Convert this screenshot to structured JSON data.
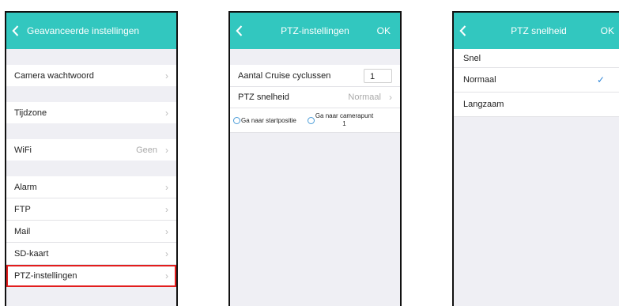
{
  "screen1": {
    "title": "Geavanceerde instellingen",
    "items": [
      {
        "label": "Camera wachtwoord"
      },
      {
        "label": "Tijdzone"
      },
      {
        "label": "WiFi",
        "value": "Geen"
      },
      {
        "label": "Alarm"
      },
      {
        "label": "FTP"
      },
      {
        "label": "Mail"
      },
      {
        "label": "SD-kaart"
      },
      {
        "label": "PTZ-instellingen"
      }
    ]
  },
  "screen2": {
    "title": "PTZ-instellingen",
    "ok": "OK",
    "cruise_label": "Aantal Cruise cyclussen",
    "cruise_value": "1",
    "speed_label": "PTZ snelheid",
    "speed_value": "Normaal",
    "radio_start": "Ga naar startpositie",
    "radio_camera_line1": "Ga naar camerapunt",
    "radio_camera_line2": "1"
  },
  "screen3": {
    "title": "PTZ snelheid",
    "ok": "OK",
    "options": [
      {
        "label": "Snel"
      },
      {
        "label": "Normaal",
        "selected": true
      },
      {
        "label": "Langzaam"
      }
    ]
  },
  "colors": {
    "accent": "#32c7bf",
    "highlight_border": "#e21d1d",
    "checkmark": "#2f86d8"
  }
}
